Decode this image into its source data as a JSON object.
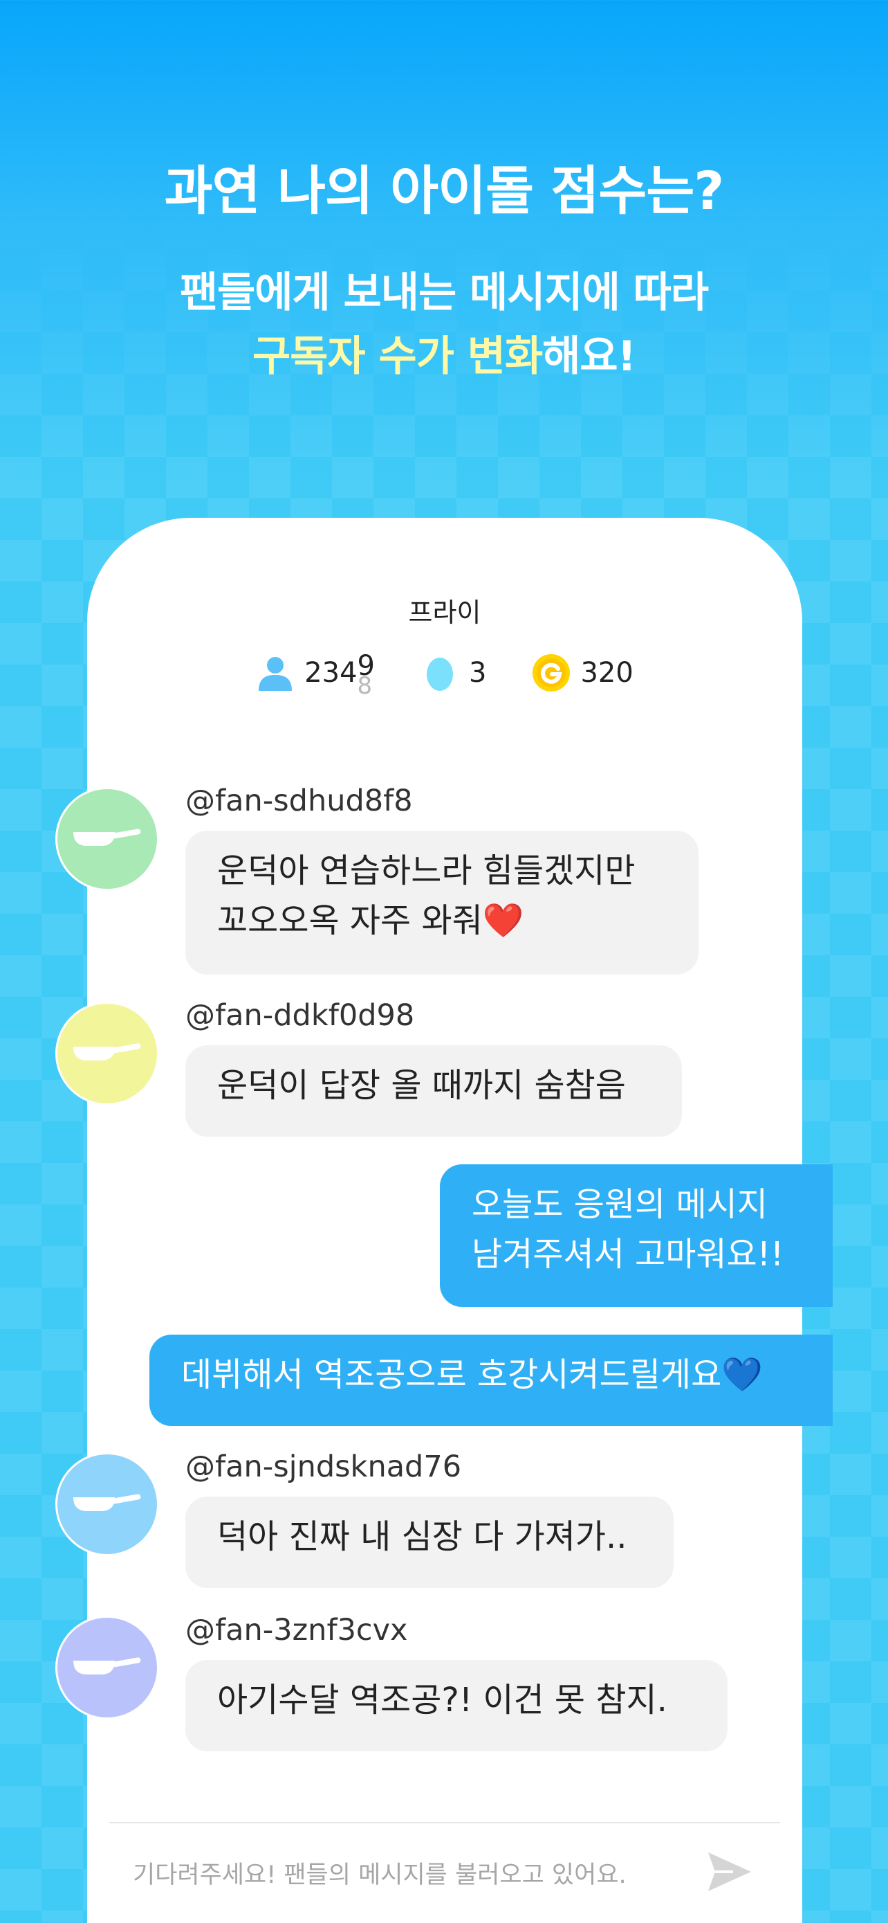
{
  "hero": {
    "title": "과연 나의 아이돌 점수는?",
    "sub_line1": "팬들에게 보내는 메시지에 따라",
    "sub_line2_highlight": "구독자 수가 변화",
    "sub_line2_rest": "해요!"
  },
  "channel": {
    "name": "프라이",
    "subscribers_prefix": "234",
    "subscribers_digit_current": "9",
    "subscribers_digit_next": "8",
    "drops": "3",
    "coins": "320"
  },
  "messages": [
    {
      "handle": "@fan-sdhud8f8",
      "line1": "운덕아 연습하느라 힘들겠지만",
      "line2": "꼬오오옥 자주 와줘❤️",
      "avatar_color": "#a8e9b5"
    },
    {
      "handle": "@fan-ddkf0d98",
      "line1": "운덕이 답장 올 때까지 숨참음",
      "avatar_color": "#f3f59a"
    },
    {
      "reply1_line1": "오늘도 응원의 메시지",
      "reply1_line2": "남겨주셔서 고마워요!!"
    },
    {
      "reply2": "데뷔해서 역조공으로 호강시켜드릴게요💙"
    },
    {
      "handle": "@fan-sjndsknad76",
      "line1": "덕아 진짜 내 심장 다 가져가..",
      "avatar_color": "#8fd4fb"
    },
    {
      "handle": "@fan-3znf3cvx",
      "line1": "아기수달 역조공?! 이건 못 참지.",
      "avatar_color": "#b9c2fb"
    }
  ],
  "input": {
    "placeholder": "기다려주세요! 팬들의 메시지를 불러오고 있어요."
  },
  "colors": {
    "accent": "#2fb0f6",
    "highlight": "#fff9a6",
    "coin": "#ffd400",
    "drop": "#7ae0fb",
    "person": "#5bc0f8"
  },
  "icons": [
    "person-icon",
    "drop-icon",
    "coin-icon",
    "frying-pan-icon",
    "send-icon"
  ]
}
